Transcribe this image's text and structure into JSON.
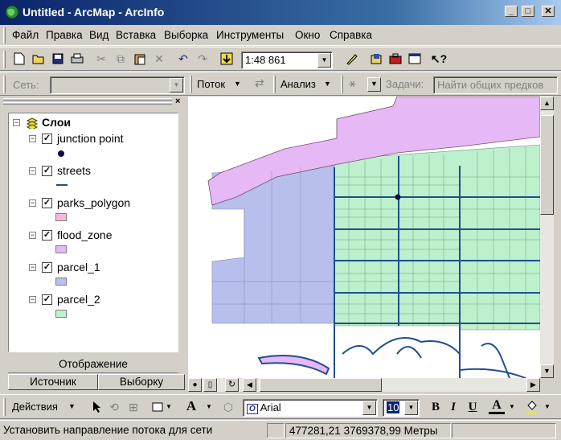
{
  "window": {
    "title": "Untitled - ArcMap - ArcInfo"
  },
  "menu": [
    "Файл",
    "Правка",
    "Вид",
    "Вставка",
    "Выборка",
    "Инструменты",
    "Окно",
    "Справка"
  ],
  "standard_toolbar": {
    "scale": "1:48 861"
  },
  "network_toolbar": {
    "network_label": "Сеть:",
    "flow_label": "Поток",
    "analysis_label": "Анализ",
    "tasks_label": "Задачи:",
    "task_value": "Найти общих предков"
  },
  "toc": {
    "root": "Слои",
    "layers": [
      {
        "name": "junction point",
        "symbol": "point",
        "color": "#101040"
      },
      {
        "name": "streets",
        "symbol": "line",
        "color": "#1f4f8f"
      },
      {
        "name": "parks_polygon",
        "symbol": "fill",
        "color": "#f5b8d8"
      },
      {
        "name": "flood_zone",
        "symbol": "fill",
        "color": "#e6b8f5"
      },
      {
        "name": "parcel_1",
        "symbol": "fill",
        "color": "#b8bfec"
      },
      {
        "name": "parcel_2",
        "symbol": "fill",
        "color": "#bdf0cc"
      }
    ],
    "tabs": [
      "Отображение",
      "Источник",
      "Выборку"
    ]
  },
  "draw_toolbar": {
    "actions_label": "Действия",
    "font": "Arial",
    "font_size": "10",
    "bold": "B",
    "italic": "I",
    "underline": "U",
    "font_color": "A"
  },
  "status": {
    "message": "Установить направление потока для сети",
    "coordinates": "477281,21  3769378,99 Метры"
  },
  "colors": {
    "parcel_1": "#b8bfec",
    "parcel_2": "#bdf0cc",
    "flood_zone": "#e6b8f5",
    "streets": "#1f4f8f"
  }
}
